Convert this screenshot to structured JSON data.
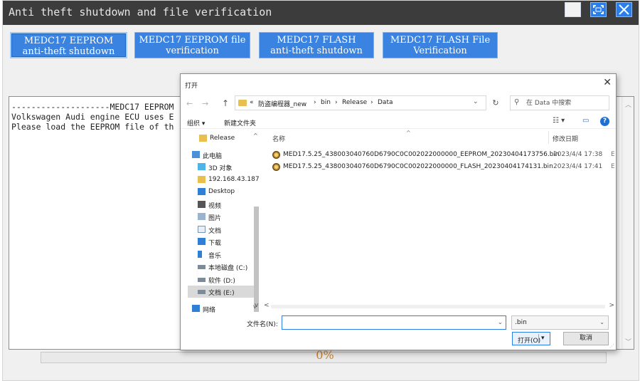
{
  "window": {
    "title": "Anti theft shutdown and file verification"
  },
  "mode_buttons": [
    {
      "line1": "MEDC17 EEPROM",
      "line2": "anti-theft shutdown"
    },
    {
      "line1": "MEDC17 EEPROM file",
      "line2": "verification"
    },
    {
      "line1": "MEDC17 FLASH",
      "line2": "anti-theft shutdown"
    },
    {
      "line1": "MEDC17 FLASH File",
      "line2": "Verification"
    }
  ],
  "log": {
    "lines": [
      "--------------------MEDC17 EEPROM",
      "Volkswagen Audi engine ECU uses E",
      "Please load the EEPROM file of th"
    ]
  },
  "progress": {
    "value": 0,
    "text": "0%"
  },
  "dialog": {
    "title": "打开",
    "breadcrumb": [
      "«",
      "防盗编程器_new",
      "›",
      "bin",
      "›",
      "Release",
      "›",
      "Data"
    ],
    "search_placeholder": "在 Data 中搜索",
    "toolbar": {
      "organize": "组织 ▾",
      "new_folder": "新建文件夹"
    },
    "nav_items": [
      {
        "label": "Release",
        "icon": "folder-icon"
      },
      {
        "label": "此电脑",
        "icon": "computer-icon"
      },
      {
        "label": "3D 对象",
        "icon": "3d-objects-icon"
      },
      {
        "label": "192.168.43.187",
        "icon": "network-drive-icon"
      },
      {
        "label": "Desktop",
        "icon": "desktop-icon"
      },
      {
        "label": "视频",
        "icon": "video-icon"
      },
      {
        "label": "图片",
        "icon": "pictures-icon"
      },
      {
        "label": "文档",
        "icon": "documents-icon"
      },
      {
        "label": "下载",
        "icon": "download-icon"
      },
      {
        "label": "音乐",
        "icon": "music-icon"
      },
      {
        "label": "本地磁盘 (C:)",
        "icon": "drive-icon"
      },
      {
        "label": "软件 (D:)",
        "icon": "drive-icon"
      },
      {
        "label": "文档 (E:)",
        "icon": "drive-icon"
      },
      {
        "label": "网络",
        "icon": "network-icon"
      }
    ],
    "columns": {
      "name": "名称",
      "date": "修改日期"
    },
    "files": [
      {
        "name": "MED17.5.25_438003040760D6790C0C002022000000_EEPROM_20230404173756.bin",
        "date": "2023/4/4 17:38",
        "extra": "E"
      },
      {
        "name": "MED17.5.25_438003040760D6790C0C002022000000_FLASH_20230404174131.bin",
        "date": "2023/4/4 17:41",
        "extra": "E"
      }
    ],
    "filename_label": "文件名(N):",
    "filename_value": "",
    "filter_value": ".bin",
    "open_label": "打开(O)",
    "cancel_label": "取消"
  },
  "colors": {
    "titlebar": "#3c3c3c",
    "accent": "#3a83e0",
    "progress_text": "#c9822a"
  }
}
